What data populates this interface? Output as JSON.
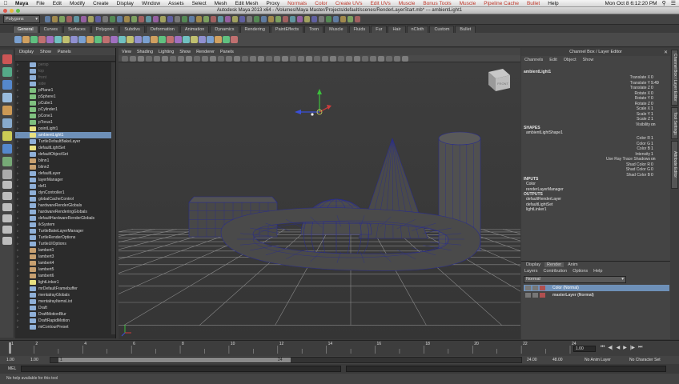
{
  "macmenu": {
    "app": "Maya",
    "items": [
      "File",
      "Edit",
      "Modify",
      "Create",
      "Display",
      "Window",
      "Assets",
      "Select",
      "Mesh",
      "Edit Mesh",
      "Proxy",
      "Normals",
      "Color",
      "Create UVs",
      "Edit UVs",
      "Muscle",
      "Bonus Tools",
      "Muscle",
      "Pipeline Cache",
      "Bullet",
      "Help"
    ],
    "clock": "Mon Oct 8  6:12:20 PM"
  },
  "window_title": "Autodesk Maya 2013 x64 - /Volumes/Maya Master/Projects/default/scenes/RenderLayerStart.mb* --- ambientLight1",
  "status": {
    "menuset": "Polygons"
  },
  "shelf": {
    "tabs": [
      "General",
      "Curves",
      "Surfaces",
      "Polygons",
      "Subdivs",
      "Deformation",
      "Animation",
      "Dynamics",
      "Rendering",
      "PaintEffects",
      "Toon",
      "Muscle",
      "Fluids",
      "Fur",
      "Hair",
      "nCloth",
      "Custom",
      "Bullet"
    ]
  },
  "outliner": {
    "menu": [
      "Display",
      "Show",
      "Panels"
    ],
    "items": [
      {
        "label": "persp",
        "dim": true
      },
      {
        "label": "top",
        "dim": true
      },
      {
        "label": "front",
        "dim": true
      },
      {
        "label": "side",
        "dim": true
      },
      {
        "label": "pPlane1"
      },
      {
        "label": "pSphere1"
      },
      {
        "label": "pCube1"
      },
      {
        "label": "pCylinder1"
      },
      {
        "label": "pCone1"
      },
      {
        "label": "pTorus1"
      },
      {
        "label": "pointLight1"
      },
      {
        "label": "ambientLight1",
        "selected": true
      },
      {
        "label": "TurtleDefaultBakeLayer"
      },
      {
        "label": "defaultLightSet"
      },
      {
        "label": "defaultObjectSet"
      },
      {
        "label": "blinn1"
      },
      {
        "label": "blinn2"
      },
      {
        "label": "defaultLayer"
      },
      {
        "label": "layerManager"
      },
      {
        "label": "dof1"
      },
      {
        "label": "dynController1"
      },
      {
        "label": "globalCacheControl"
      },
      {
        "label": "hardwareRenderGlobals"
      },
      {
        "label": "hardwareRenderingGlobals"
      },
      {
        "label": "defaultHardwareRenderGlobals"
      },
      {
        "label": "ikSystem"
      },
      {
        "label": "TurtleBakeLayerManager"
      },
      {
        "label": "TurtleRenderOptions"
      },
      {
        "label": "TurtleUIOptions"
      },
      {
        "label": "lambert1"
      },
      {
        "label": "lambert3"
      },
      {
        "label": "lambert4"
      },
      {
        "label": "lambert5"
      },
      {
        "label": "lambert6"
      },
      {
        "label": "lightLinker1"
      },
      {
        "label": "mrDefaultFramebuffer"
      },
      {
        "label": "mentalrayGlobals"
      },
      {
        "label": "mentalrayItemsList"
      },
      {
        "label": "Draft"
      },
      {
        "label": "DraftMotionBlur"
      },
      {
        "label": "DraftRapidMotion"
      },
      {
        "label": "miContourPreset"
      }
    ]
  },
  "viewport": {
    "menu": [
      "View",
      "Shading",
      "Lighting",
      "Show",
      "Renderer",
      "Panels"
    ],
    "viewcube_label": "FRONT"
  },
  "channelbox": {
    "header": "Channel Box / Layer Editor",
    "menu": [
      "Channels",
      "Edit",
      "Object",
      "Show"
    ],
    "object": "ambientLight1",
    "transform": [
      {
        "label": "Translate X",
        "value": "0"
      },
      {
        "label": "Translate Y",
        "value": "9.49"
      },
      {
        "label": "Translate Z",
        "value": "0"
      },
      {
        "label": "Rotate X",
        "value": "0"
      },
      {
        "label": "Rotate Y",
        "value": "0"
      },
      {
        "label": "Rotate Z",
        "value": "0"
      },
      {
        "label": "Scale X",
        "value": "1"
      },
      {
        "label": "Scale Y",
        "value": "1"
      },
      {
        "label": "Scale Z",
        "value": "1"
      },
      {
        "label": "Visibility",
        "value": "on"
      }
    ],
    "shapes_title": "SHAPES",
    "shape_name": "ambientLightShape1",
    "shape_attrs": [
      {
        "label": "Color R",
        "value": "1"
      },
      {
        "label": "Color G",
        "value": "1"
      },
      {
        "label": "Color B",
        "value": "1"
      },
      {
        "label": "Intensity",
        "value": "1"
      },
      {
        "label": "Use Ray Trace Shadows",
        "value": "on"
      },
      {
        "label": "Shad Color R",
        "value": "0"
      },
      {
        "label": "Shad Color G",
        "value": "0"
      },
      {
        "label": "Shad Color B",
        "value": "0"
      }
    ],
    "inputs_title": "INPUTS",
    "inputs": [
      "Color",
      "renderLayerManager"
    ],
    "outputs_title": "OUTPUTS",
    "outputs": [
      "defaultRenderLayer",
      "defaultLightSet",
      "lightLinker1"
    ]
  },
  "layer_editor": {
    "tabs": [
      "Display",
      "Render",
      "Anim"
    ],
    "active_tab": "Render",
    "menu": [
      "Layers",
      "Contribution",
      "Options",
      "Help"
    ],
    "mode": "Normal",
    "layers": [
      {
        "name": "Color (Normal)",
        "selected": true
      },
      {
        "name": "masterLayer (Normal)",
        "selected": false
      }
    ]
  },
  "sidetabs": [
    "Channel Box / Layer Editor",
    "Tool Settings",
    "Attribute Editor"
  ],
  "timeline": {
    "ticks": [
      "1",
      "2",
      "4",
      "6",
      "8",
      "10",
      "12",
      "14",
      "16",
      "18",
      "20",
      "22",
      "24"
    ],
    "current_frame": "1.00"
  },
  "range": {
    "start": "1.00",
    "anim_start": "1.00",
    "range_start_box": "1",
    "range_end_box": "24",
    "range_end": "24.00",
    "anim_end": "48.00",
    "anim_layer": "No Anim Layer",
    "char_set": "No Character Set"
  },
  "cmdline": {
    "label": "MEL"
  },
  "helpline": "No help available for this tool",
  "colors": {
    "selection": "#6e90b8",
    "wire": "#2a2d8c",
    "grid": "#8a8a8a",
    "axis_y": "#3cbf3c",
    "axis_x": "#d03c3c",
    "axis_z": "#3a4fd8"
  }
}
